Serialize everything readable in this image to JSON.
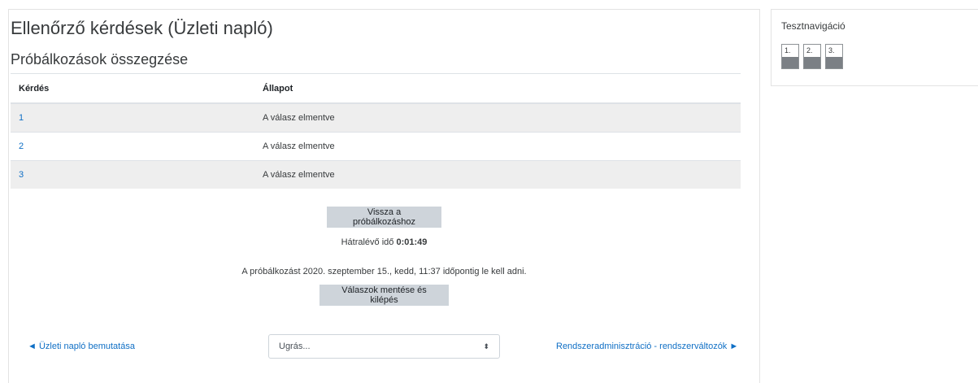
{
  "main": {
    "title": "Ellenőrző kérdések (Üzleti napló)",
    "section_title": "Próbálkozások összegzése",
    "table": {
      "headers": [
        "Kérdés",
        "Állapot"
      ],
      "rows": [
        {
          "question": "1",
          "status": "A válasz elmentve"
        },
        {
          "question": "2",
          "status": "A válasz elmentve"
        },
        {
          "question": "3",
          "status": "A válasz elmentve"
        }
      ]
    },
    "return_button": "Vissza a próbálkozáshoz",
    "timer_label": "Hátralévő idő",
    "timer_value": "0:01:49",
    "deadline_text": "A próbálkozást 2020. szeptember 15., kedd, 11:37 időpontig le kell adni.",
    "submit_button": "Válaszok mentése és kilépés"
  },
  "footer_nav": {
    "prev_arrow": "◄",
    "prev_label": "Üzleti napló bemutatása",
    "jump_placeholder": "Ugrás...",
    "jump_caret": "⬍",
    "next_label": "Rendszeradminisztráció - rendszerváltozók",
    "next_arrow": "►"
  },
  "sidebar": {
    "title": "Tesztnavigáció",
    "questions": [
      "1.",
      "2.",
      "3."
    ]
  }
}
